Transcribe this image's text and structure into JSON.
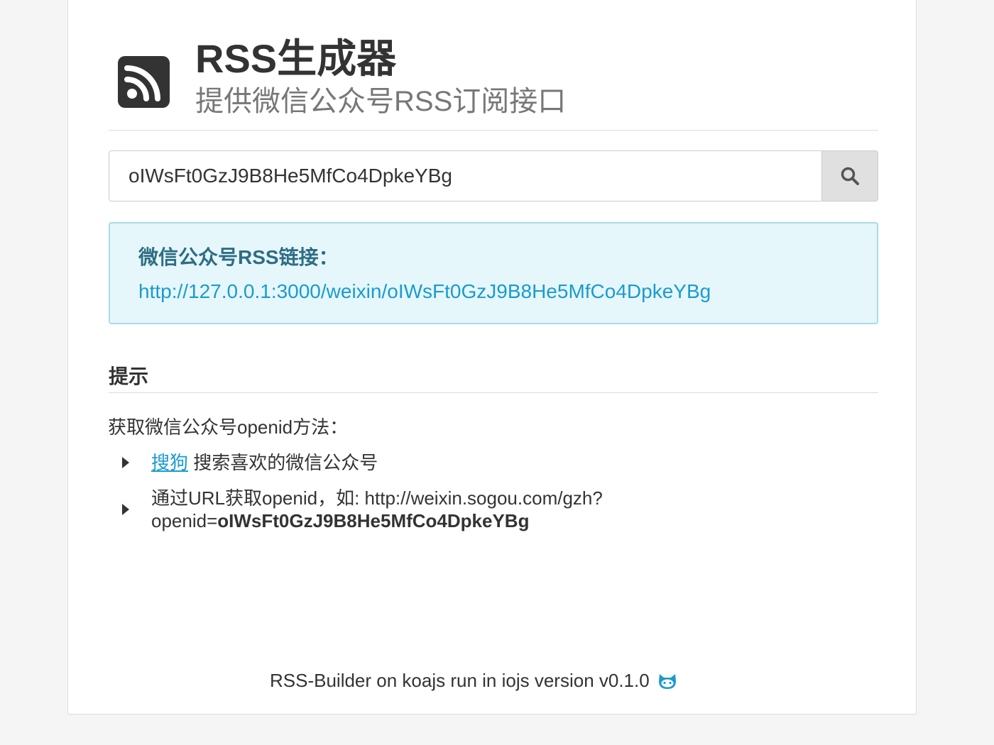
{
  "header": {
    "title": "RSS生成器",
    "subtitle": "提供微信公众号RSS订阅接口",
    "logo_icon": "rss-icon"
  },
  "search": {
    "value": "oIWsFt0GzJ9B8He5MfCo4DpkeYBg",
    "button_icon": "search-icon"
  },
  "result": {
    "label": "微信公众号RSS链接：",
    "link": "http://127.0.0.1:3000/weixin/oIWsFt0GzJ9B8He5MfCo4DpkeYBg"
  },
  "tips": {
    "title": "提示",
    "intro": "获取微信公众号openid方法：",
    "items": [
      {
        "link_text": "搜狗",
        "text": " 搜索喜欢的微信公众号"
      },
      {
        "text_line1": "通过URL获取openid，如: http://weixin.sogou.com/gzh?",
        "text_line2_prefix": "openid=",
        "text_line2_bold": "oIWsFt0GzJ9B8He5MfCo4DpkeYBg"
      }
    ]
  },
  "footer": {
    "text": "RSS-Builder on koajs run in iojs version v0.1.0",
    "icon": "github-octocat-icon"
  },
  "colors": {
    "accent": "#1a9bd0",
    "info_bg": "#e6f7fb",
    "info_border": "#a8dbe8",
    "info_label": "#2e6d84"
  }
}
